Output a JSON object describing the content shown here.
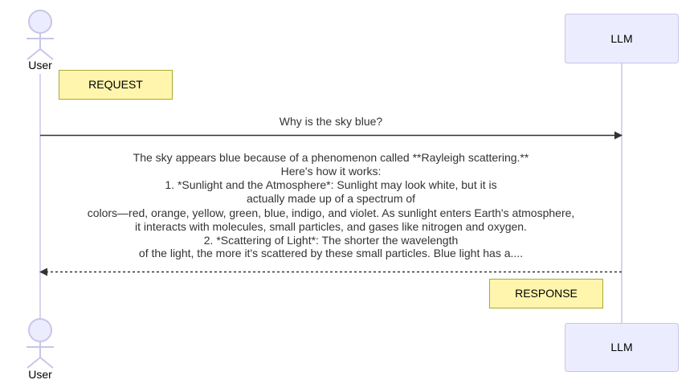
{
  "diagram": {
    "participants": {
      "user_label": "User",
      "llm_label": "LLM"
    },
    "notes": {
      "request_label": "REQUEST",
      "response_label": "RESPONSE"
    },
    "messages": {
      "request_text": "Why is the sky blue?",
      "response_lines": [
        "The sky appears blue because of a phenomenon called **Rayleigh scattering.**",
        "Here's how it works:",
        "1. *Sunlight and the Atmosphere*: Sunlight may look white, but it is",
        "actually made up of a spectrum of",
        "colors—red, orange, yellow, green, blue, indigo, and violet. As sunlight enters Earth's atmosphere,",
        "it interacts with molecules, small particles, and gases like nitrogen and oxygen.",
        "2. *Scattering of Light*: The shorter the wavelength",
        "of the light, the more it's scattered by these small particles. Blue light has a...."
      ]
    },
    "colors": {
      "actor_fill": "#ECECFF",
      "actor_stroke": "#C8C6E8",
      "lifeline": "#C8C6E8",
      "note_fill": "#FFF5AD",
      "note_stroke": "#AAAA33",
      "message_line": "#333333"
    }
  }
}
